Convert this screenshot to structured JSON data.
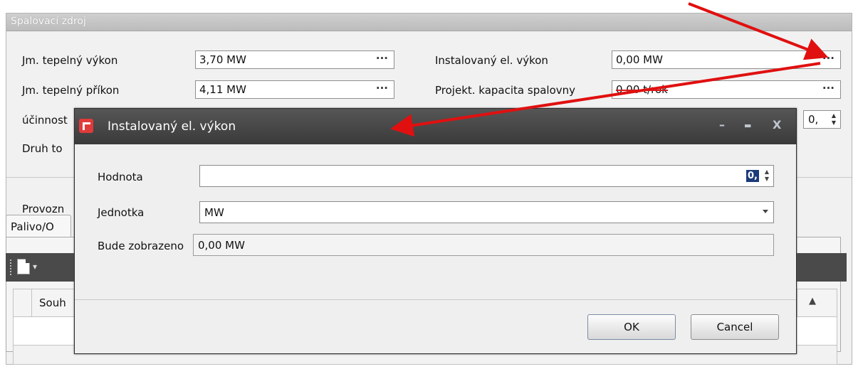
{
  "panel": {
    "title": "Spalovací zdroj",
    "rows": [
      {
        "label": "Jm. tepelný výkon",
        "value": "3,70 MW"
      },
      {
        "label": "Jm. tepelný příkon",
        "value": "4,11 MW"
      }
    ],
    "right_rows": [
      {
        "label": "Instalovaný el. výkon",
        "value": "0,00 MW"
      },
      {
        "label": "Projekt. kapacita spalovny",
        "value": "0,00 t/rok"
      }
    ],
    "partial_labels": {
      "ucinnost": "účinnost",
      "druh": "Druh to",
      "provoz": "Provozn"
    },
    "spin_value": "0,",
    "tab_label": "Palivo/O",
    "grid_header": "Souh",
    "sort_icon": "▲",
    "ellipsis": "···"
  },
  "dialog": {
    "title": "Instalovaný el. výkon",
    "fields": {
      "hodnota": {
        "label": "Hodnota",
        "value": "",
        "spin_text": "0,"
      },
      "jednotka": {
        "label": "Jednotka",
        "value": "MW"
      },
      "zobrazeno": {
        "label": "Bude zobrazeno",
        "value": "0,00 MW"
      }
    },
    "buttons": {
      "ok": "OK",
      "cancel": "Cancel"
    },
    "window_controls": {
      "minimize": "–",
      "maximize": "▬",
      "close": "X"
    }
  },
  "colors": {
    "arrow": "#e01010",
    "dialog_title_bg": "#3f3f3f",
    "panel_header_bg": "#c6c6c6"
  }
}
